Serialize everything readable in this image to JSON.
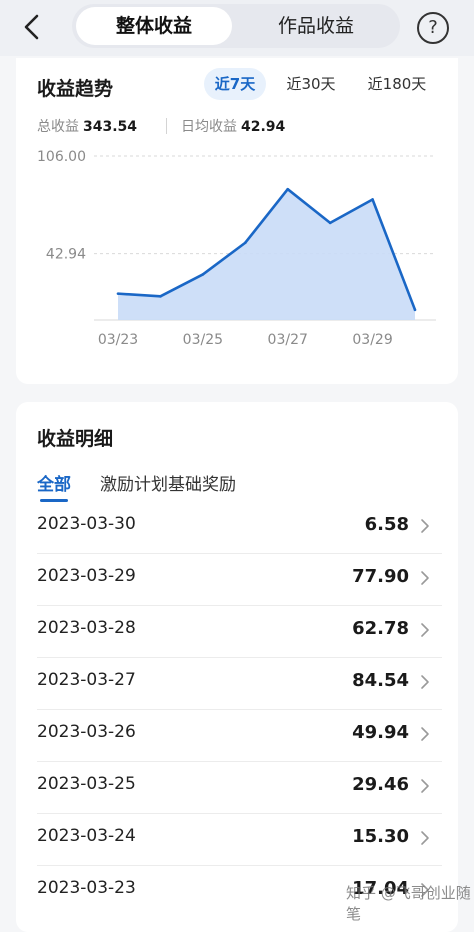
{
  "header": {
    "tabs": [
      "整体收益",
      "作品收益"
    ],
    "help": "?"
  },
  "trend": {
    "title": "收益趋势",
    "ranges": [
      "近7天",
      "近30天",
      "近180天"
    ],
    "total_label": "总收益",
    "total_value": "343.54",
    "daily_label": "日均收益",
    "daily_value": "42.94"
  },
  "chart_data": {
    "type": "area",
    "title": "",
    "x": [
      "03/23",
      "03/24",
      "03/25",
      "03/26",
      "03/27",
      "03/28",
      "03/29",
      "03/30"
    ],
    "x_tick_labels": [
      "03/23",
      "03/25",
      "03/27",
      "03/29"
    ],
    "values": [
      17.04,
      15.3,
      29.46,
      49.94,
      84.54,
      62.78,
      77.9,
      6.58
    ],
    "y_tick_labels": [
      "106.00",
      "42.94"
    ],
    "ylim": [
      0,
      106.0
    ],
    "line_color": "#1a67c6",
    "fill_color": "#c9dcf7",
    "grid": "dashed horizontal"
  },
  "detail": {
    "title": "收益明细",
    "filters": [
      "全部",
      "激励计划基础奖励"
    ],
    "rows": [
      {
        "date": "2023-03-30",
        "value": "6.58"
      },
      {
        "date": "2023-03-29",
        "value": "77.90"
      },
      {
        "date": "2023-03-28",
        "value": "62.78"
      },
      {
        "date": "2023-03-27",
        "value": "84.54"
      },
      {
        "date": "2023-03-26",
        "value": "49.94"
      },
      {
        "date": "2023-03-25",
        "value": "29.46"
      },
      {
        "date": "2023-03-24",
        "value": "15.30"
      },
      {
        "date": "2023-03-23",
        "value": "17.04"
      }
    ]
  },
  "watermark": "知乎 @飞哥创业随笔",
  "colors": {
    "accent": "#1a67c6",
    "background": "#f5f6f8"
  }
}
